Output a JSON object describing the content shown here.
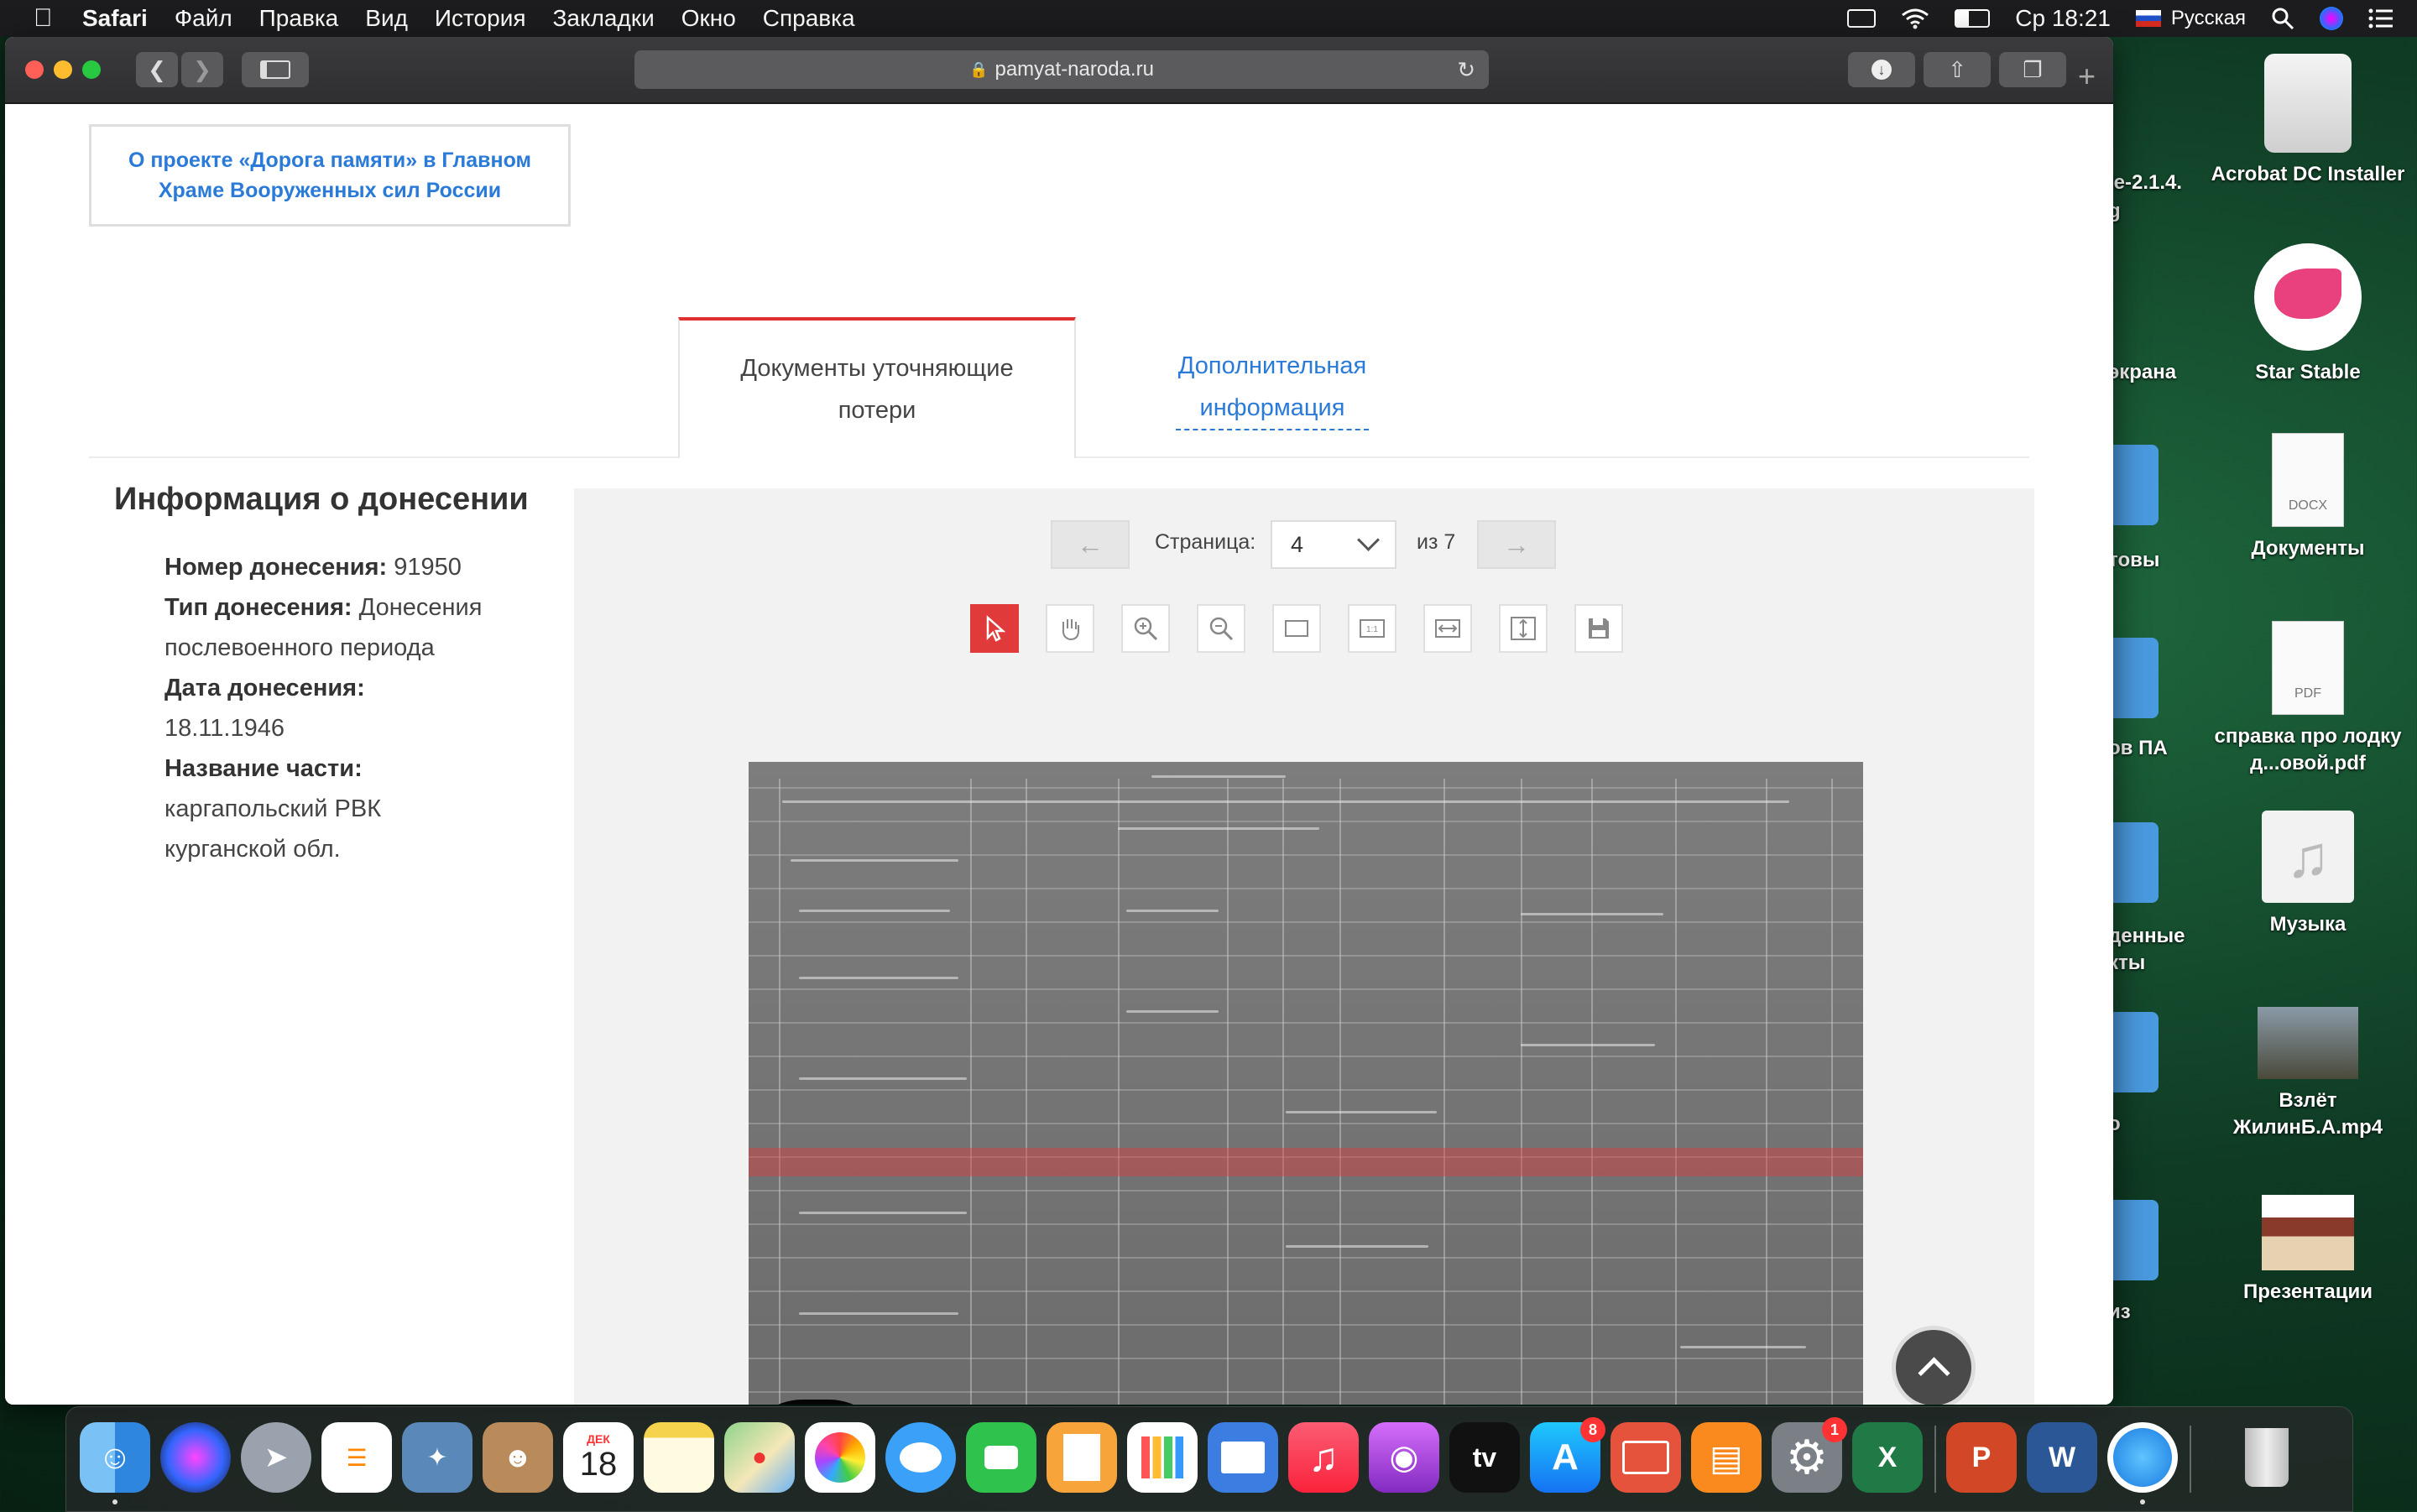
{
  "menubar": {
    "app": "Safari",
    "items": [
      "Файл",
      "Правка",
      "Вид",
      "История",
      "Закладки",
      "Окно",
      "Справка"
    ],
    "clock": "Ср 18:21",
    "input_source": "Русская"
  },
  "browser": {
    "url": "pamyat-naroda.ru"
  },
  "page": {
    "project_link": "О проекте «Дорога памяти» в Главном Храме Вооруженных сил России",
    "tabs": [
      {
        "label": "Документы уточняющие потери"
      },
      {
        "label": "Дополнительная информация"
      }
    ],
    "info": {
      "title": "Информация о донесении",
      "number_label": "Номер донесения:",
      "number_value": "91950",
      "type_label": "Тип донесения:",
      "type_value": "Донесения послевоенного периода",
      "date_label": "Дата донесения:",
      "date_value": "18.11.1946",
      "unit_label": "Название части:",
      "unit_value": "каргапольский РВК курганской обл."
    },
    "viewer": {
      "prev": "←",
      "next": "→",
      "page_label": "Страница:",
      "page_value": "4",
      "total": "из 7",
      "tools": [
        "cursor-icon",
        "hand-icon",
        "zoom-in-icon",
        "zoom-out-icon",
        "fit-page-icon",
        "actual-size-icon",
        "fit-width-icon",
        "fit-height-icon",
        "save-icon"
      ],
      "active_tool": "cursor-icon",
      "accent": "#e03a3a"
    }
  },
  "desktop": {
    "icons": [
      {
        "label": "Acrobat DC Installer"
      },
      {
        "label": "Star Stable"
      },
      {
        "label": "Документы",
        "badge": "DOCX"
      },
      {
        "label": "справка про лодку д...овой.pdf",
        "badge": "PDF"
      },
      {
        "label": "Музыка"
      },
      {
        "label": "Взлёт ЖилинБ.А.mp4"
      },
      {
        "label": "Презентации"
      }
    ],
    "partial_labels": [
      "le-2.1.4.",
      "g",
      "экрана",
      "товы",
      "ов ПА",
      "денные",
      "кты",
      "о",
      "из"
    ]
  },
  "dock": {
    "calendar_month": "ДЕК",
    "calendar_day": "18",
    "appstore_badge": "8",
    "settings_badge": "1",
    "tv_label": "tv"
  }
}
